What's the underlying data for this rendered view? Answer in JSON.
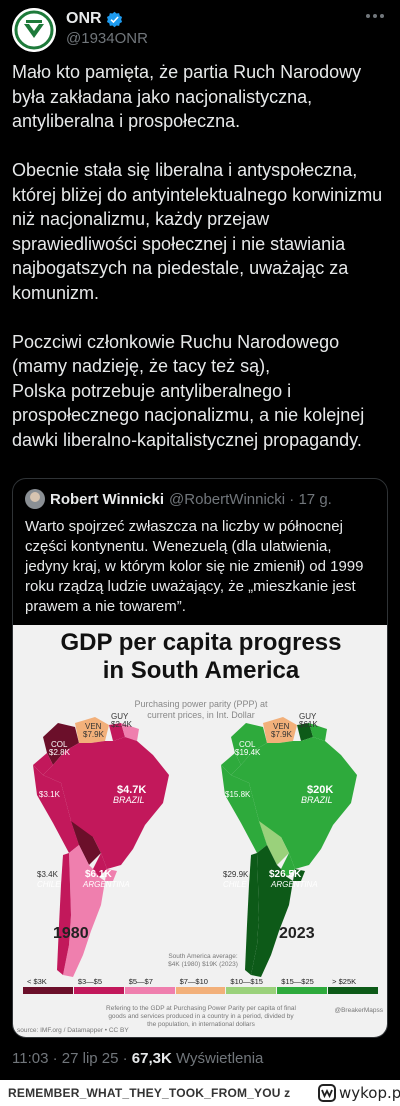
{
  "tweet": {
    "author_name": "ONR",
    "author_handle": "@1934ONR",
    "body": "Mało kto pamięta, że partia Ruch Narodowy była zakładana jako nacjonalistyczna, antyliberalna i prospołeczna.\n\nObecnie stała się liberalna i antyspołeczna, której bliżej do antyintelektualnego korwinizmu niż nacjonalizmu, każdy przejaw sprawiedliwości społecznej i nie stawiania najbogatszych na piedestale, uważając za komunizm.\n\nPoczciwi członkowie Ruchu Narodowego (mamy nadzieję, że tacy też są),\nPolska potrzebuje antyliberalnego i prospołecznego nacjonalizmu, a nie kolejnej dawki liberalno-kapitalistycznej propagandy.",
    "time": "11:03 · 27 lip 25 · ",
    "views_count": "67,3K",
    "views_label": " Wyświetlenia"
  },
  "quote": {
    "author_name": "Robert Winnicki",
    "meta": "@RobertWinnicki · 17 g.",
    "body": "Warto spojrzeć zwłaszcza na liczby w północnej części kontynentu. Wenezuelą (dla ulatwienia, jedyny kraj, w którym kolor się nie zmienił) od 1999 roku rządzą ludzie uważający, że „mieszkanie jest prawem a nie towarem”."
  },
  "infographic": {
    "title_line1": "GDP per capita progress",
    "title_line2": "in South America",
    "subtitle_line1": "Purchasing power parity (PPP) at",
    "subtitle_line2": "current prices, in Int. Dollar",
    "year_left": "1980",
    "year_right": "2023",
    "labels_1980": {
      "ven": "VEN",
      "ven_val": "$7.9K",
      "guy": "GUY",
      "guy_val": "$2.4K",
      "col": "COL",
      "col_val": "$2.8K",
      "peru_val": "$3.1K",
      "brazil_val": "$4.7K",
      "brazil": "BRAZIL",
      "chile_val": "$3.4K",
      "chile": "CHILE",
      "arg_val": "$6.1K",
      "argentina": "ARGENTINA"
    },
    "labels_2023": {
      "ven": "VEN",
      "ven_val": "$7.9K",
      "guy": "GUY",
      "guy_val": "$61K",
      "col": "COL",
      "col_val": "$19.4K",
      "peru_val": "$15.8K",
      "brazil_val": "$20K",
      "brazil": "BRAZIL",
      "chile_val": "$29.9K",
      "chile": "CHILE",
      "arg_val": "$26.5K",
      "argentina": "ARGENTINA"
    },
    "avg_line1": "South America average:",
    "avg_line2": "$4K (1980) $19K (2023)",
    "legend": [
      {
        "label": "< $3K",
        "color": "#6b0f2a"
      },
      {
        "label": "$3—$5",
        "color": "#c2185b"
      },
      {
        "label": "$5—$7",
        "color": "#ef7fae"
      },
      {
        "label": "$7—$10",
        "color": "#f2b07a"
      },
      {
        "label": "$10—$15",
        "color": "#9ad17b"
      },
      {
        "label": "$15—$25",
        "color": "#2eaa3c"
      },
      {
        "label": "> $25K",
        "color": "#0d5a18"
      }
    ],
    "note_line1": "Refering to the GDP at Purchasing Power Parity per capita of final",
    "note_line2": "goods and services produced in a country in a period, divided by",
    "note_line3": "the population, in international dollars",
    "source": "source: IMF.org / Datamapper • CC BY",
    "credit": "@BreakerMapss"
  },
  "footer": {
    "text": "REMEMBER_WHAT_THEY_TOOK_FROM_YOU z",
    "logo_text": "wykop.pl"
  },
  "colors": {
    "background": "#000000",
    "text": "#e7e9ea",
    "muted": "#71767b",
    "verified": "#1d9bf0",
    "border": "#2f3336"
  }
}
